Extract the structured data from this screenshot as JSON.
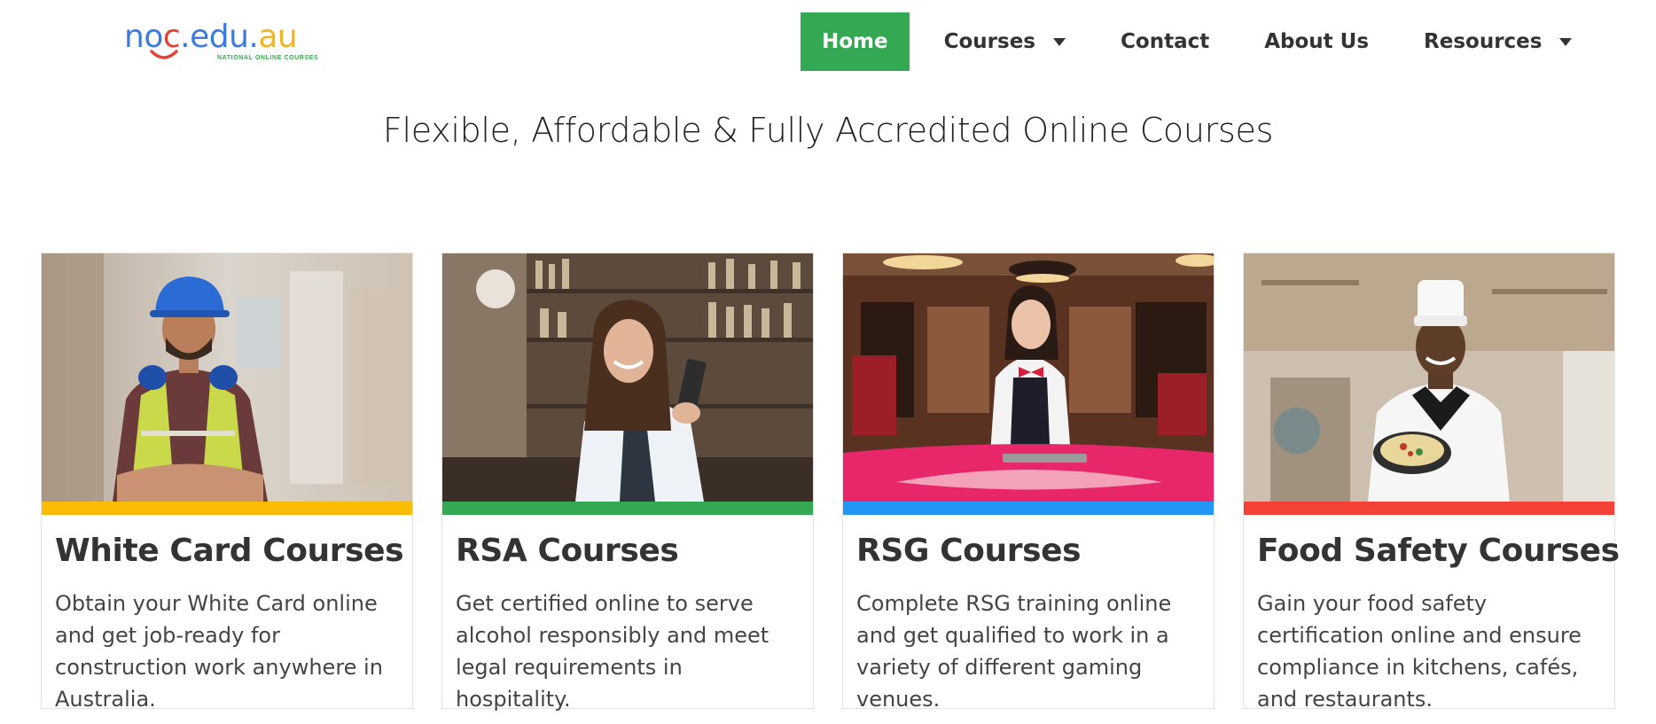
{
  "logo": {
    "parts": [
      "no",
      "c",
      ".edu.",
      "au"
    ],
    "subtitle": "NATIONAL ONLINE COURSES"
  },
  "nav": {
    "items": [
      {
        "label": "Home",
        "active": true,
        "dropdown": false
      },
      {
        "label": "Courses",
        "active": false,
        "dropdown": true
      },
      {
        "label": "Contact",
        "active": false,
        "dropdown": false
      },
      {
        "label": "About Us",
        "active": false,
        "dropdown": false
      },
      {
        "label": "Resources",
        "active": false,
        "dropdown": true
      }
    ]
  },
  "tagline": "Flexible, Affordable & Fully Accredited Online Courses",
  "cards": [
    {
      "title": "White Card Courses",
      "description": "Obtain your White Card online and get job-ready for construction work anywhere in Australia.",
      "accent": "#fbbc05",
      "image": "construction-worker-photo"
    },
    {
      "title": "RSA Courses",
      "description": "Get certified online to serve alcohol responsibly and meet legal requirements in hospitality.",
      "accent": "#34a853",
      "image": "bartender-photo"
    },
    {
      "title": "RSG Courses",
      "description": "Complete RSG training online and get qualified to work in a variety of different gaming venues.",
      "accent": "#2196f3",
      "image": "casino-dealer-photo"
    },
    {
      "title": "Food Safety Courses",
      "description": "Gain your food safety certification online and ensure compliance in kitchens, cafés, and restaurants.",
      "accent": "#f44336",
      "image": "chef-photo"
    }
  ],
  "colors": {
    "brand_blue": "#3b7be0",
    "brand_red": "#e3443a",
    "brand_yellow": "#f2b51f",
    "brand_green": "#34a853"
  }
}
